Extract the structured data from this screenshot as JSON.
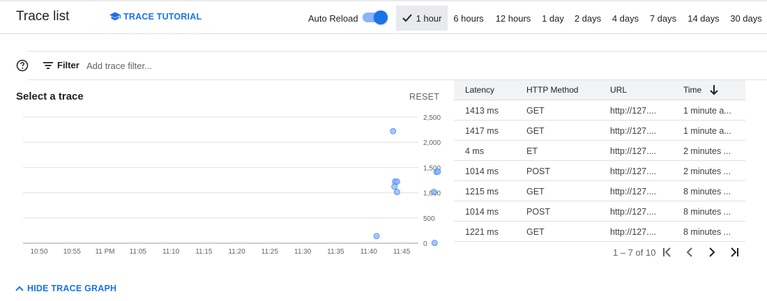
{
  "header": {
    "title": "Trace list",
    "tutorial_label": "TRACE TUTORIAL",
    "auto_reload_label": "Auto Reload",
    "auto_reload_on": true,
    "time_ranges": [
      "1 hour",
      "6 hours",
      "12 hours",
      "1 day",
      "2 days",
      "4 days",
      "7 days",
      "14 days",
      "30 days"
    ],
    "selected_range": "1 hour"
  },
  "filter": {
    "label": "Filter",
    "placeholder": "Add trace filter..."
  },
  "chart_panel": {
    "title": "Select a trace",
    "reset_label": "RESET",
    "hide_label": "HIDE TRACE GRAPH"
  },
  "chart_data": {
    "type": "scatter",
    "title": "Select a trace",
    "xlabel": "",
    "ylabel": "",
    "x_ticks": [
      "10:50",
      "10:55",
      "11 PM",
      "11:05",
      "11:10",
      "11:15",
      "11:20",
      "11:25",
      "11:30",
      "11:35",
      "11:40",
      "11:45"
    ],
    "y_ticks": [
      "0",
      "500",
      "1,000",
      "1,500",
      "2,000",
      "2,500"
    ],
    "ylim": [
      0,
      2500
    ],
    "xlim_minutes": [
      0,
      57.5
    ],
    "y_axis_position": "right",
    "grid": true,
    "point_color": "#8ab4f8",
    "points": [
      {
        "t": 53.7,
        "latency": 2220
      },
      {
        "t": 51.2,
        "latency": 140
      },
      {
        "t": 54.0,
        "latency": 1220
      },
      {
        "t": 54.3,
        "latency": 1220
      },
      {
        "t": 53.9,
        "latency": 1120
      },
      {
        "t": 54.3,
        "latency": 1014
      },
      {
        "t": 60.3,
        "latency": 1413
      },
      {
        "t": 60.5,
        "latency": 1417
      },
      {
        "t": 59.9,
        "latency": 1014
      },
      {
        "t": 60.0,
        "latency": 4
      }
    ]
  },
  "table": {
    "columns": [
      "Latency",
      "HTTP Method",
      "URL",
      "Time"
    ],
    "rows": [
      [
        "1413 ms",
        "GET",
        "http://127....",
        "1 minute a..."
      ],
      [
        "1417 ms",
        "GET",
        "http://127....",
        "1 minute a..."
      ],
      [
        "4 ms",
        "ET",
        "http://127....",
        "2 minutes ..."
      ],
      [
        "1014 ms",
        "POST",
        "http://127....",
        "2 minutes ..."
      ],
      [
        "1215 ms",
        "GET",
        "http://127....",
        "8 minutes ..."
      ],
      [
        "1014 ms",
        "POST",
        "http://127....",
        "8 minutes ..."
      ],
      [
        "1221 ms",
        "GET",
        "http://127....",
        "8 minutes ..."
      ]
    ]
  },
  "pagination": {
    "range_label": "1 – 7 of 10"
  },
  "colors": {
    "accent": "#1a73e8",
    "point": "#8ab4f8"
  }
}
